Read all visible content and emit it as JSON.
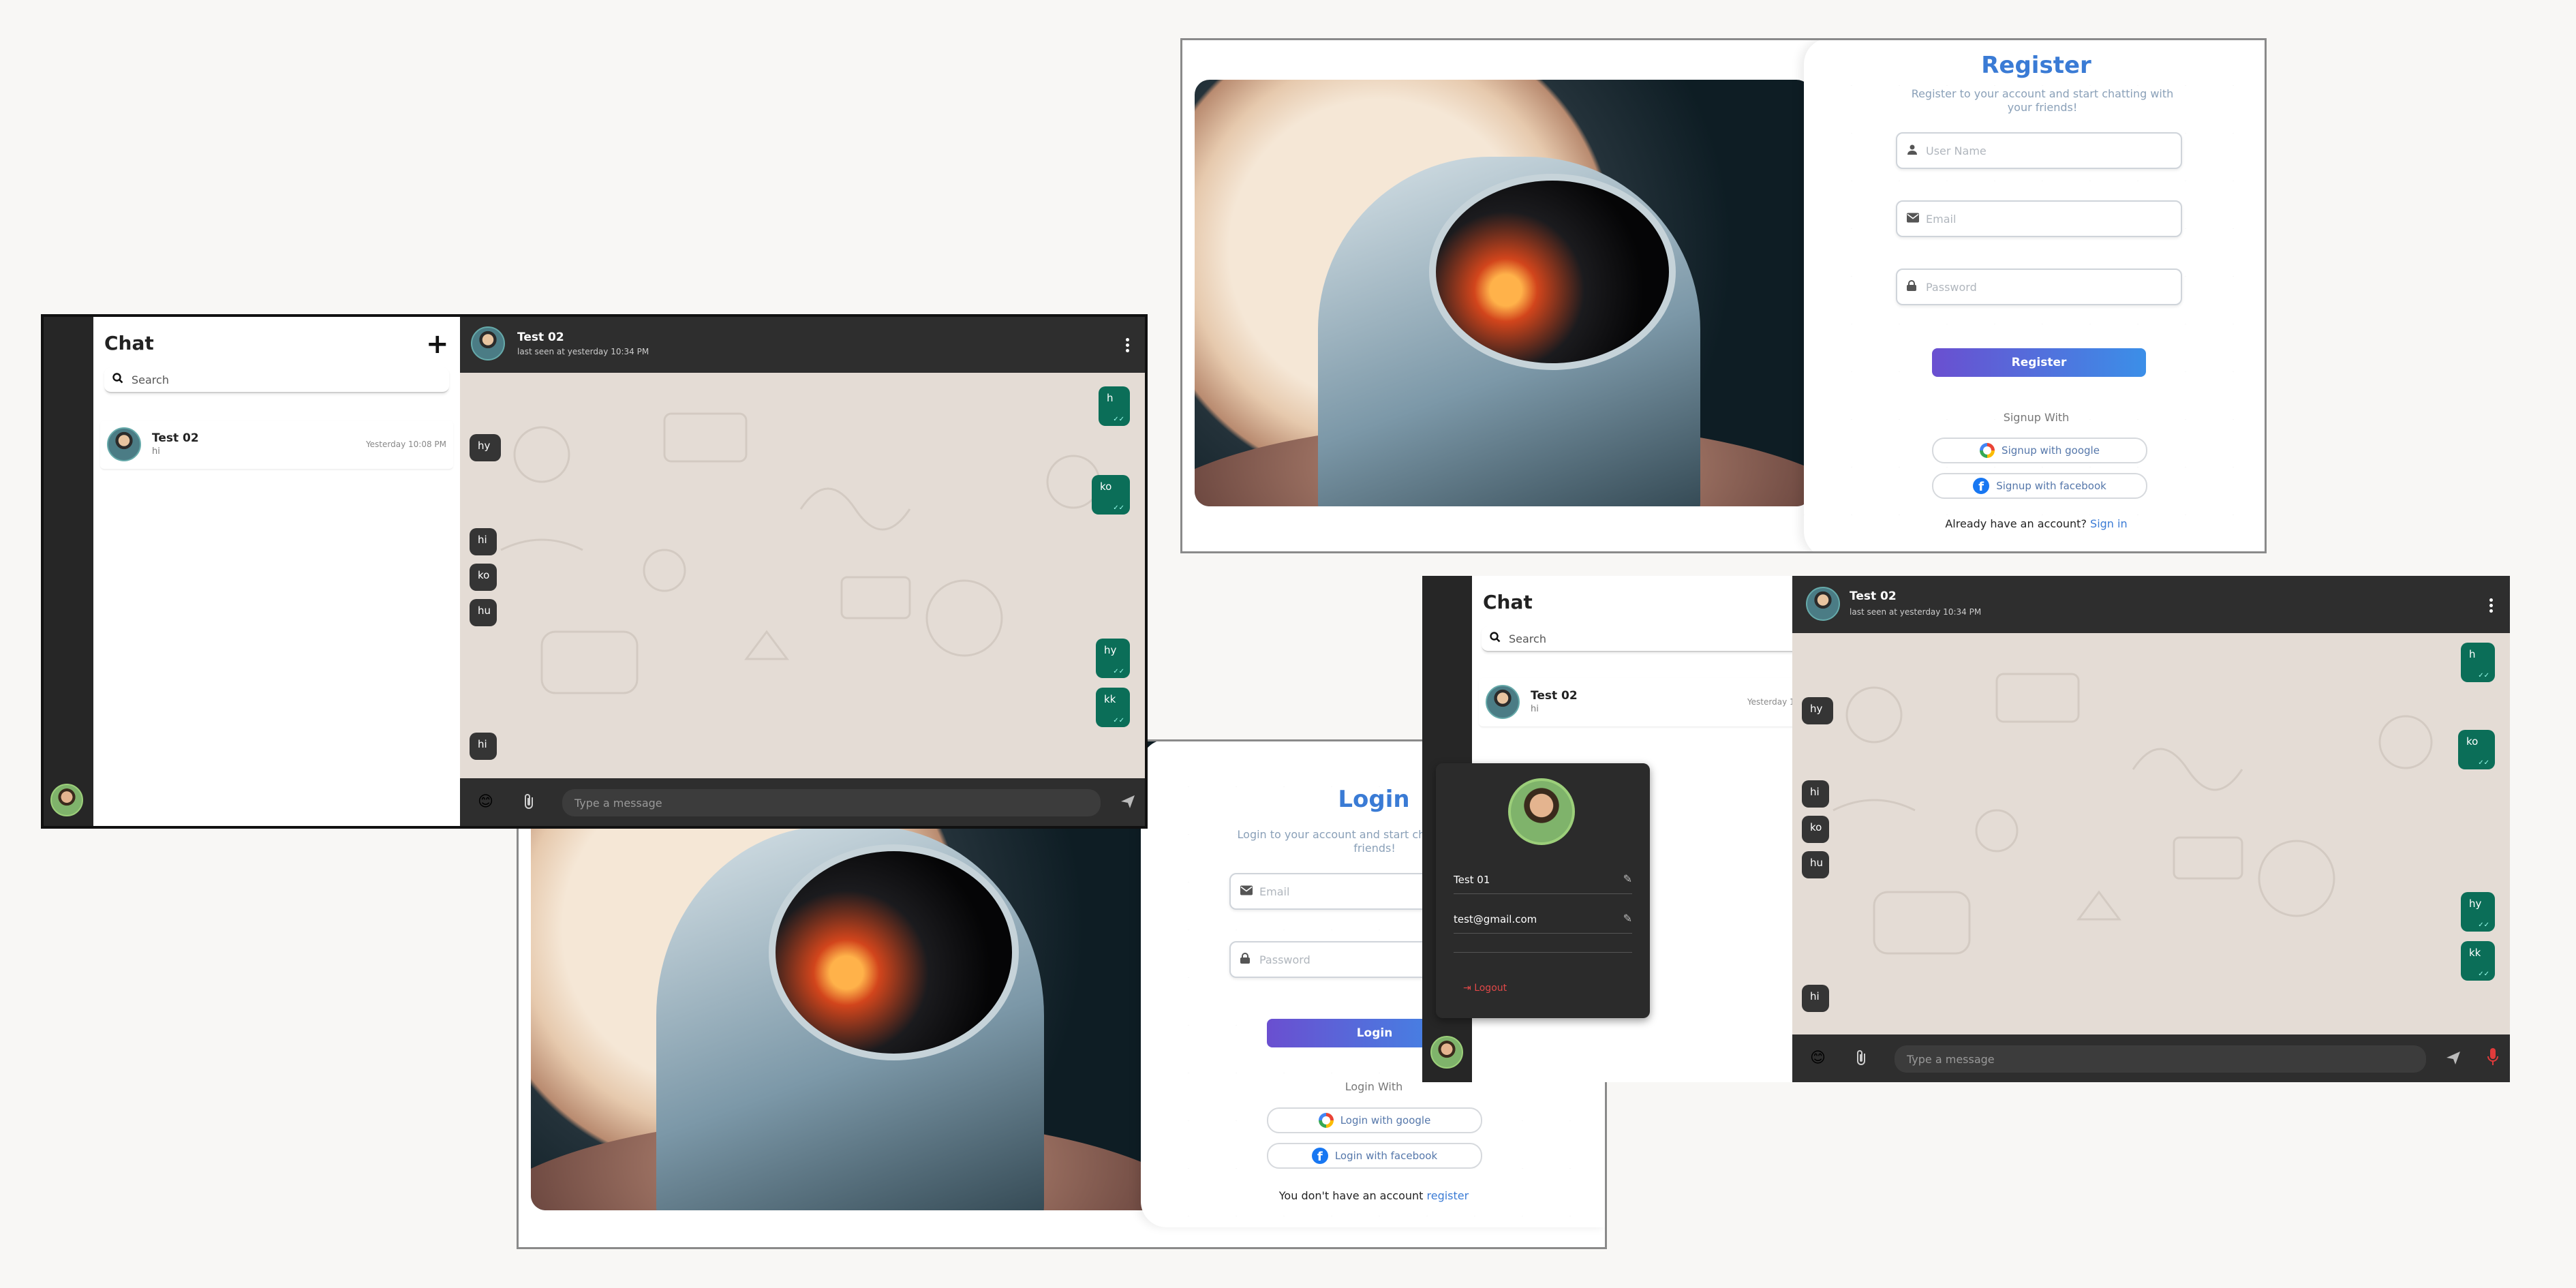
{
  "chat_app": {
    "title": "Chat",
    "add_icon": "plus-icon",
    "search_placeholder": "Search",
    "contacts": [
      {
        "name": "Test 02",
        "last_message": "hi",
        "time": "Yesterday 10:08 PM"
      }
    ],
    "header": {
      "name": "Test 02",
      "last_seen": "last seen at yesterday 10:34 PM"
    },
    "messages": [
      {
        "text": "h",
        "dir": "out"
      },
      {
        "text": "hy",
        "dir": "in"
      },
      {
        "text": "ko",
        "dir": "out"
      },
      {
        "text": "hi",
        "dir": "in"
      },
      {
        "text": "ko",
        "dir": "in"
      },
      {
        "text": "hu",
        "dir": "in"
      },
      {
        "text": "hy",
        "dir": "out"
      },
      {
        "text": "kk",
        "dir": "out"
      },
      {
        "text": "hi",
        "dir": "in"
      }
    ],
    "input_placeholder": "Type a message",
    "read_ticks": "✓✓"
  },
  "register": {
    "title": "Register",
    "subtitle": "Register to your account and start chatting with your friends!",
    "username_placeholder": "User Name",
    "email_placeholder": "Email",
    "password_placeholder": "Password",
    "button": "Register",
    "with_label": "Signup With",
    "google": "Signup with google",
    "facebook": "Signup with facebook",
    "footer_text": "Already have an account?",
    "footer_link": "Sign in"
  },
  "login": {
    "title": "Login",
    "subtitle": "Login to your account and start chatting with your friends!",
    "email_placeholder": "Email",
    "password_placeholder": "Password",
    "button": "Login",
    "with_label": "Login With",
    "google": "Login with google",
    "facebook": "Login with facebook",
    "footer_text": "You don't have an account",
    "footer_link": "register"
  },
  "profile_popup": {
    "name": "Test 01",
    "email": "test@gmail.com",
    "logout": "Logout"
  },
  "colors": {
    "accent_blue": "#3a7bd5",
    "outgoing_bubble": "#0b6e58",
    "incoming_bubble": "#353535",
    "dark_bar": "#2e2e2e",
    "mic_red": "#e03b3b"
  }
}
